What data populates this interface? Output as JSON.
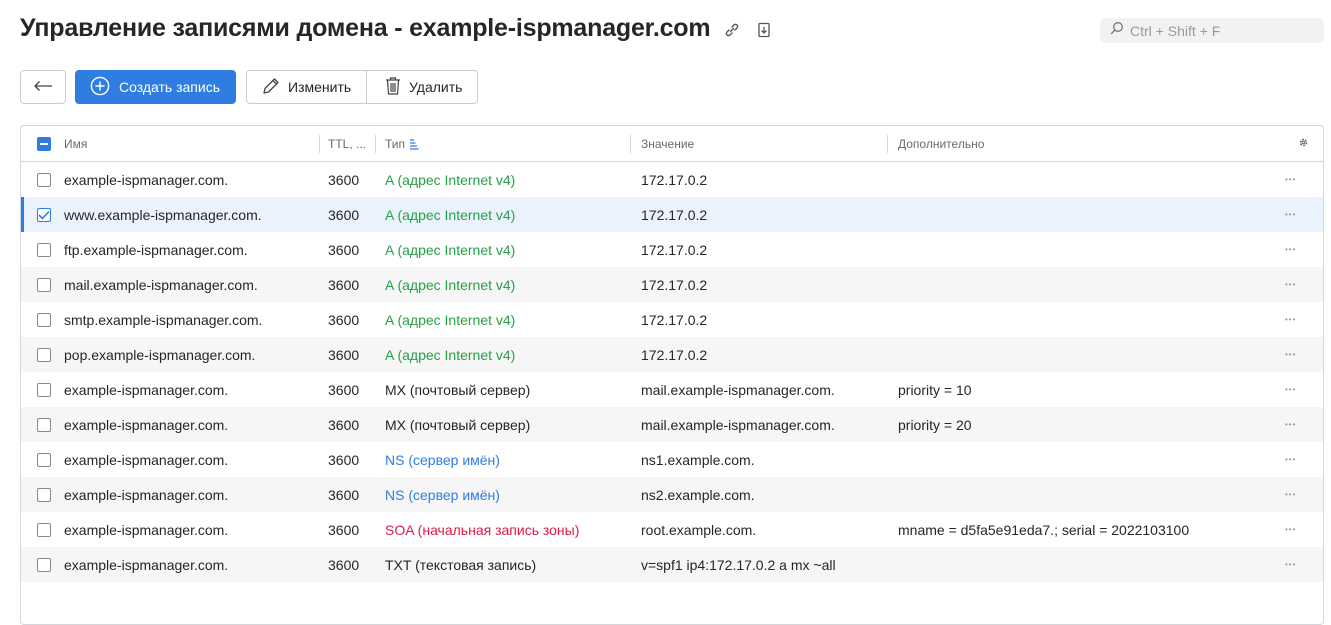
{
  "page": {
    "title": "Управление записями домена - example-ispmanager.com"
  },
  "search": {
    "placeholder": "Ctrl + Shift + F"
  },
  "toolbar": {
    "create_label": "Создать запись",
    "edit_label": "Изменить",
    "delete_label": "Удалить"
  },
  "colors": {
    "accent": "#2f7de1",
    "type_a": "#27a045",
    "type_ns": "#2f7de1",
    "type_soa": "#e0194c"
  },
  "table": {
    "columns": {
      "name": "Имя",
      "ttl": "TTL, ...",
      "type": "Тип",
      "value": "Значение",
      "extra": "Дополнительно"
    },
    "rows": [
      {
        "name": "example-ispmanager.com.",
        "ttl": "3600",
        "type": "A (адрес Internet v4)",
        "kind": "a",
        "value": "172.17.0.2",
        "extra": "",
        "checked": false
      },
      {
        "name": "www.example-ispmanager.com.",
        "ttl": "3600",
        "type": "A (адрес Internet v4)",
        "kind": "a",
        "value": "172.17.0.2",
        "extra": "",
        "checked": true
      },
      {
        "name": "ftp.example-ispmanager.com.",
        "ttl": "3600",
        "type": "A (адрес Internet v4)",
        "kind": "a",
        "value": "172.17.0.2",
        "extra": "",
        "checked": false
      },
      {
        "name": "mail.example-ispmanager.com.",
        "ttl": "3600",
        "type": "A (адрес Internet v4)",
        "kind": "a",
        "value": "172.17.0.2",
        "extra": "",
        "checked": false
      },
      {
        "name": "smtp.example-ispmanager.com.",
        "ttl": "3600",
        "type": "A (адрес Internet v4)",
        "kind": "a",
        "value": "172.17.0.2",
        "extra": "",
        "checked": false
      },
      {
        "name": "pop.example-ispmanager.com.",
        "ttl": "3600",
        "type": "A (адрес Internet v4)",
        "kind": "a",
        "value": "172.17.0.2",
        "extra": "",
        "checked": false
      },
      {
        "name": "example-ispmanager.com.",
        "ttl": "3600",
        "type": "MX (почтовый сервер)",
        "kind": "def",
        "value": "mail.example-ispmanager.com.",
        "extra": "priority = 10",
        "checked": false
      },
      {
        "name": "example-ispmanager.com.",
        "ttl": "3600",
        "type": "MX (почтовый сервер)",
        "kind": "def",
        "value": "mail.example-ispmanager.com.",
        "extra": "priority = 20",
        "checked": false
      },
      {
        "name": "example-ispmanager.com.",
        "ttl": "3600",
        "type": "NS (сервер имён)",
        "kind": "ns",
        "value": "ns1.example.com.",
        "extra": "",
        "checked": false
      },
      {
        "name": "example-ispmanager.com.",
        "ttl": "3600",
        "type": "NS (сервер имён)",
        "kind": "ns",
        "value": "ns2.example.com.",
        "extra": "",
        "checked": false
      },
      {
        "name": "example-ispmanager.com.",
        "ttl": "3600",
        "type": "SOA (начальная запись зоны)",
        "kind": "soa",
        "value": "root.example.com.",
        "extra": "mname = d5fa5e91eda7.; serial = 2022103100",
        "checked": false
      },
      {
        "name": "example-ispmanager.com.",
        "ttl": "3600",
        "type": "TXT (текстовая запись)",
        "kind": "def",
        "value": "v=spf1 ip4:172.17.0.2 a mx ~all",
        "extra": "",
        "checked": false
      }
    ]
  }
}
